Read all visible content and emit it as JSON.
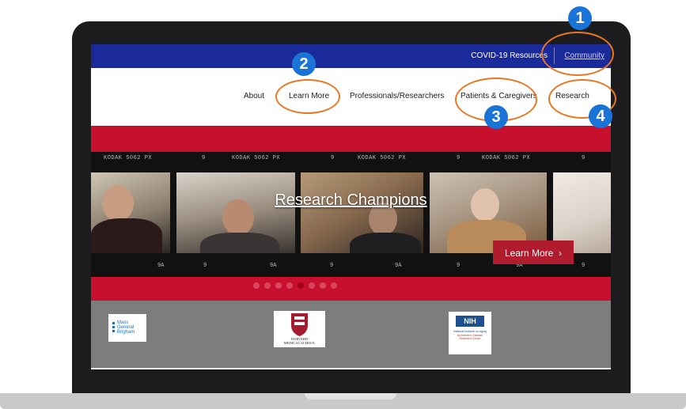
{
  "topbar": {
    "covid_link": "COVID-19 Resources",
    "community_link": "Community"
  },
  "nav": {
    "items": [
      {
        "label": "About"
      },
      {
        "label": "Learn More"
      },
      {
        "label": "Professionals/Researchers"
      },
      {
        "label": "Patients & Caregivers"
      },
      {
        "label": "Research"
      }
    ]
  },
  "hero": {
    "title": "Research Champions",
    "button_label": "Learn More",
    "button_icon": "chevron-right-icon",
    "film_edge_text": [
      "KODAK 5062 PX",
      "9",
      "KODAK 5062 PX",
      "9",
      "KODAK 5062 PX",
      "9",
      "KODAK 5062 PX",
      "9"
    ],
    "film_bottom_marks": [
      "9A",
      "9",
      "9A",
      "9",
      "9A",
      "9",
      "9A",
      "9"
    ],
    "carousel_slide_count": 8,
    "carousel_active_index": 4
  },
  "partners": [
    {
      "name": "Mass General Brigham",
      "line1": "Mass",
      "line2": "General",
      "line3": "Brigham"
    },
    {
      "name": "Harvard Medical School",
      "line1": "HARVARD",
      "line2": "MEDICAL SCHOOL"
    },
    {
      "name": "NIH",
      "line1": "NIH",
      "line2": "National Institute on Aging",
      "line3": "Alzheimer's Disease",
      "line4": "Research Center"
    }
  ],
  "annotations": [
    {
      "number": "1"
    },
    {
      "number": "2"
    },
    {
      "number": "3"
    },
    {
      "number": "4"
    }
  ],
  "colors": {
    "topbar": "#1b2a9b",
    "brand_red": "#c8102e",
    "annotation_circle": "#e87722",
    "annotation_badge": "#1a73d6"
  }
}
